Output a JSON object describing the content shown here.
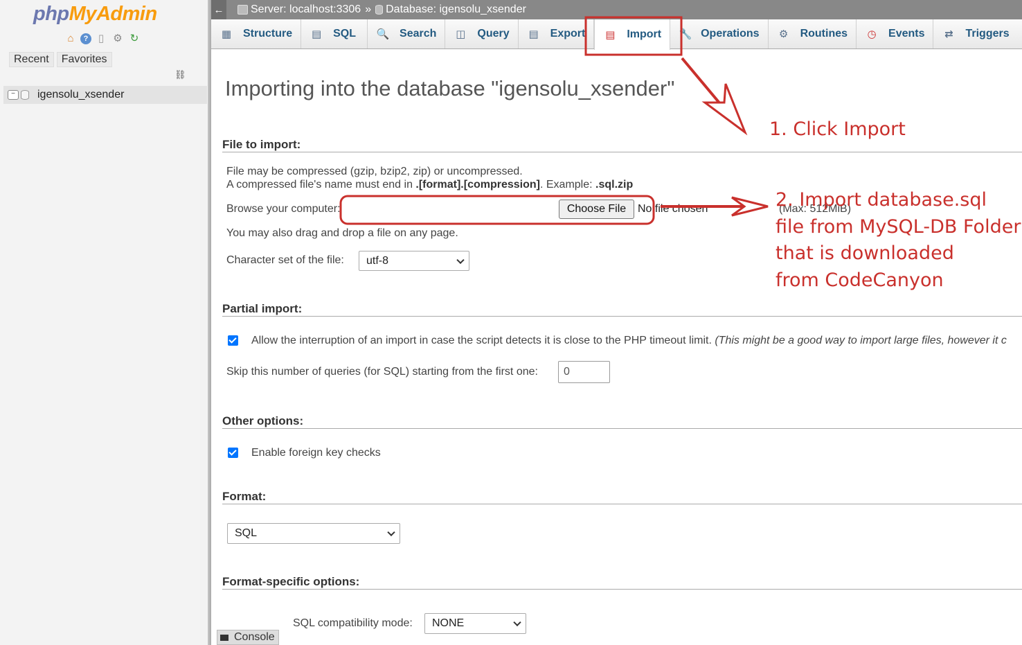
{
  "nav": {
    "logo_php": "php",
    "logo_myadmin": "MyAdmin",
    "icons": [
      "home-icon",
      "help-icon",
      "docs-icon",
      "settings-icon",
      "reload-icon"
    ],
    "recent": "Recent",
    "favorites": "Favorites",
    "database": "igensolu_xsender"
  },
  "breadcrumb": {
    "back": "←",
    "server": "Server: localhost:3306",
    "separator": "»",
    "database": "Database: igensolu_xsender"
  },
  "tabs": [
    {
      "label": "Structure",
      "icon": "structure-icon"
    },
    {
      "label": "SQL",
      "icon": "sql-icon"
    },
    {
      "label": "Search",
      "icon": "search-icon"
    },
    {
      "label": "Query",
      "icon": "query-icon"
    },
    {
      "label": "Export",
      "icon": "export-icon"
    },
    {
      "label": "Import",
      "icon": "import-icon",
      "active": true
    },
    {
      "label": "Operations",
      "icon": "wrench-icon"
    },
    {
      "label": "Routines",
      "icon": "routines-icon"
    },
    {
      "label": "Events",
      "icon": "clock-icon"
    },
    {
      "label": "Triggers",
      "icon": "triggers-icon"
    }
  ],
  "main": {
    "title": "Importing into the database \"igensolu_xsender\"",
    "file_section": {
      "heading": "File to import:",
      "line1": "File may be compressed (gzip, bzip2, zip) or uncompressed.",
      "line2_prefix": "A compressed file's name must end in ",
      "line2_bold": ".[format].[compression]",
      "line2_mid": ". Example: ",
      "line2_example": ".sql.zip",
      "browse_label": "Browse your computer:",
      "choose_button": "Choose File",
      "no_file": "No file chosen",
      "max_size": "(Max: 512MiB)",
      "drag_hint": "You may also drag and drop a file on any page.",
      "charset_label": "Character set of the file:",
      "charset_value": "utf-8"
    },
    "partial_section": {
      "heading": "Partial import:",
      "allow_interrupt": "Allow the interruption of an import in case the script detects it is close to the PHP timeout limit.",
      "allow_interrupt_note": "(This might be a good way to import large files, however it c",
      "skip_label": "Skip this number of queries (for SQL) starting from the first one:",
      "skip_value": "0"
    },
    "other_section": {
      "heading": "Other options:",
      "fk_checks": "Enable foreign key checks"
    },
    "format_section": {
      "heading": "Format:",
      "format_value": "SQL"
    },
    "format_specific": {
      "heading": "Format-specific options:",
      "compat_label": "SQL compatibility mode:",
      "compat_value": "NONE"
    },
    "console": "Console"
  },
  "annotations": {
    "step1": "1. Click Import",
    "step2_lines": [
      "2. Import database.sql",
      "file from MySQL-DB Folder",
      "that is downloaded",
      "from CodeCanyon"
    ],
    "color": "#c9302c"
  }
}
